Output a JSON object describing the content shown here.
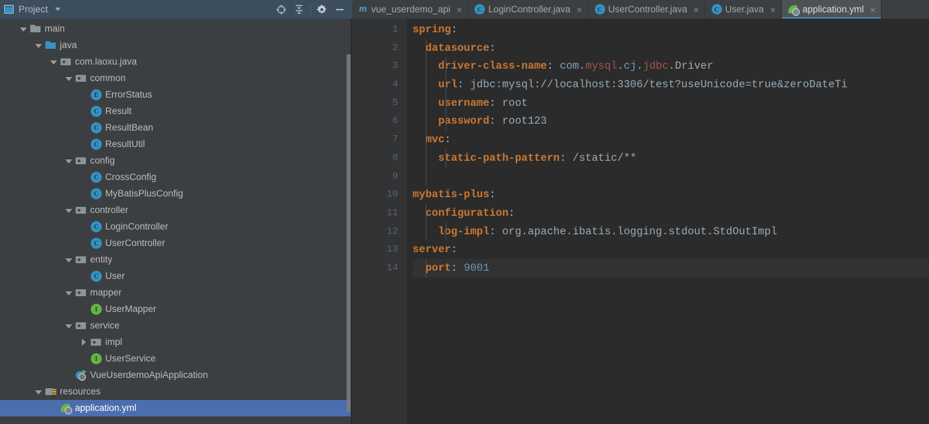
{
  "window": {
    "theme_bg": "#3c3f41",
    "editor_bg": "#2b2b2b",
    "selection_color": "#4b6eaf",
    "accent_color": "#4a88c7"
  },
  "project_panel": {
    "title": "Project",
    "dropdown_icon": "chevron-down-icon",
    "panel_icon": "project-panel-icon",
    "toolbar": [
      {
        "name": "locate-icon",
        "tooltip": "Select Opened File"
      },
      {
        "name": "collapse-all-icon",
        "tooltip": "Collapse All"
      },
      {
        "name": "gear-icon",
        "tooltip": "Settings"
      },
      {
        "name": "minimize-icon",
        "tooltip": "Hide"
      }
    ],
    "tree": [
      {
        "label": "main",
        "indent": 1,
        "arrow": "down",
        "icon": "folder",
        "kind": "folder",
        "selected": false
      },
      {
        "label": "java",
        "indent": 2,
        "arrow": "down",
        "icon": "folder-src",
        "kind": "folder",
        "selected": false
      },
      {
        "label": "com.laoxu.java",
        "indent": 3,
        "arrow": "down",
        "icon": "pkg",
        "kind": "package",
        "selected": false
      },
      {
        "label": "common",
        "indent": 4,
        "arrow": "down",
        "icon": "pkg",
        "kind": "package",
        "selected": false
      },
      {
        "label": "ErrorStatus",
        "indent": 5,
        "arrow": "none",
        "icon": "enum",
        "kind": "enum",
        "selected": false
      },
      {
        "label": "Result",
        "indent": 5,
        "arrow": "none",
        "icon": "class",
        "kind": "class",
        "selected": false
      },
      {
        "label": "ResultBean",
        "indent": 5,
        "arrow": "none",
        "icon": "class",
        "kind": "class",
        "selected": false
      },
      {
        "label": "ResultUtil",
        "indent": 5,
        "arrow": "none",
        "icon": "class",
        "kind": "class",
        "selected": false
      },
      {
        "label": "config",
        "indent": 4,
        "arrow": "down",
        "icon": "pkg",
        "kind": "package",
        "selected": false
      },
      {
        "label": "CrossConfig",
        "indent": 5,
        "arrow": "none",
        "icon": "class",
        "kind": "class",
        "selected": false
      },
      {
        "label": "MyBatisPlusConfig",
        "indent": 5,
        "arrow": "none",
        "icon": "class",
        "kind": "class",
        "selected": false
      },
      {
        "label": "controller",
        "indent": 4,
        "arrow": "down",
        "icon": "pkg",
        "kind": "package",
        "selected": false
      },
      {
        "label": "LoginController",
        "indent": 5,
        "arrow": "none",
        "icon": "class",
        "kind": "class",
        "selected": false
      },
      {
        "label": "UserController",
        "indent": 5,
        "arrow": "none",
        "icon": "class",
        "kind": "class",
        "selected": false
      },
      {
        "label": "entity",
        "indent": 4,
        "arrow": "down",
        "icon": "pkg",
        "kind": "package",
        "selected": false
      },
      {
        "label": "User",
        "indent": 5,
        "arrow": "none",
        "icon": "class",
        "kind": "class",
        "selected": false
      },
      {
        "label": "mapper",
        "indent": 4,
        "arrow": "down",
        "icon": "pkg",
        "kind": "package",
        "selected": false
      },
      {
        "label": "UserMapper",
        "indent": 5,
        "arrow": "none",
        "icon": "interface",
        "kind": "interface",
        "selected": false
      },
      {
        "label": "service",
        "indent": 4,
        "arrow": "down",
        "icon": "pkg",
        "kind": "package",
        "selected": false
      },
      {
        "label": "impl",
        "indent": 5,
        "arrow": "right",
        "icon": "pkg",
        "kind": "package",
        "selected": false
      },
      {
        "label": "UserService",
        "indent": 5,
        "arrow": "none",
        "icon": "interface",
        "kind": "interface",
        "selected": false
      },
      {
        "label": "VueUserdemoApiApplication",
        "indent": 4,
        "arrow": "none",
        "icon": "springapp",
        "kind": "spring-application",
        "selected": false
      },
      {
        "label": "resources",
        "indent": 2,
        "arrow": "down",
        "icon": "res",
        "kind": "resources-folder",
        "selected": false
      },
      {
        "label": "application.yml",
        "indent": 3,
        "arrow": "none",
        "icon": "spring",
        "kind": "yaml",
        "selected": true
      }
    ],
    "scrollbar": {
      "name": "tree-vertical-scrollbar"
    }
  },
  "editor": {
    "tabs": [
      {
        "label": "vue_userdemo_api",
        "icon": "maven-module-icon",
        "active": false,
        "closable": true
      },
      {
        "label": "LoginController.java",
        "icon": "java-class-icon",
        "active": false,
        "closable": true
      },
      {
        "label": "UserController.java",
        "icon": "java-class-icon",
        "active": false,
        "closable": true
      },
      {
        "label": "User.java",
        "icon": "java-class-icon",
        "active": false,
        "closable": true
      },
      {
        "label": "application.yml",
        "icon": "spring-yaml-icon",
        "active": true,
        "closable": true
      }
    ],
    "close_glyph": "×",
    "current_line": 14,
    "lines": [
      {
        "no": 1,
        "fold": "pent",
        "indent": 0,
        "tokens": [
          {
            "t": "spring",
            "c": "key"
          },
          {
            "t": ":",
            "c": "colon"
          }
        ]
      },
      {
        "no": 2,
        "fold": "pent",
        "indent": 1,
        "tokens": [
          {
            "t": "datasource",
            "c": "key"
          },
          {
            "t": ":",
            "c": "colon"
          }
        ]
      },
      {
        "no": 3,
        "fold": null,
        "indent": 2,
        "tokens": [
          {
            "t": "driver-class-name",
            "c": "key"
          },
          {
            "t": ": ",
            "c": "colon"
          },
          {
            "t": "com",
            "c": "t1"
          },
          {
            "t": ".",
            "c": "plain"
          },
          {
            "t": "mysql",
            "c": "t2"
          },
          {
            "t": ".",
            "c": "plain"
          },
          {
            "t": "cj",
            "c": "t3"
          },
          {
            "t": ".",
            "c": "plain"
          },
          {
            "t": "jdbc",
            "c": "t4"
          },
          {
            "t": ".",
            "c": "plain"
          },
          {
            "t": "Driver",
            "c": "plain"
          }
        ]
      },
      {
        "no": 4,
        "fold": null,
        "indent": 2,
        "tokens": [
          {
            "t": "url",
            "c": "key"
          },
          {
            "t": ": ",
            "c": "colon"
          },
          {
            "t": "jdbc:mysql://localhost:3306/test?useUnicode=true&zeroDateTi",
            "c": "plain"
          }
        ]
      },
      {
        "no": 5,
        "fold": null,
        "indent": 2,
        "tokens": [
          {
            "t": "username",
            "c": "key"
          },
          {
            "t": ": ",
            "c": "colon"
          },
          {
            "t": "root",
            "c": "plain"
          }
        ]
      },
      {
        "no": 6,
        "fold": "square",
        "indent": 2,
        "tokens": [
          {
            "t": "password",
            "c": "key"
          },
          {
            "t": ": ",
            "c": "colon"
          },
          {
            "t": "root123",
            "c": "plain"
          }
        ]
      },
      {
        "no": 7,
        "fold": "pent",
        "indent": 1,
        "tokens": [
          {
            "t": "mvc",
            "c": "key"
          },
          {
            "t": ":",
            "c": "colon"
          }
        ]
      },
      {
        "no": 8,
        "fold": "square",
        "indent": 2,
        "tokens": [
          {
            "t": "static-path-pattern",
            "c": "key"
          },
          {
            "t": ": ",
            "c": "colon"
          },
          {
            "t": "/static/**",
            "c": "plain"
          }
        ]
      },
      {
        "no": 9,
        "fold": null,
        "indent": 0,
        "tokens": []
      },
      {
        "no": 10,
        "fold": "pent",
        "indent": 0,
        "tokens": [
          {
            "t": "mybatis-plus",
            "c": "key"
          },
          {
            "t": ":",
            "c": "colon"
          }
        ]
      },
      {
        "no": 11,
        "fold": "pent",
        "indent": 1,
        "tokens": [
          {
            "t": "configuration",
            "c": "key"
          },
          {
            "t": ":",
            "c": "colon"
          }
        ]
      },
      {
        "no": 12,
        "fold": "square",
        "indent": 2,
        "tokens": [
          {
            "t": "log-impl",
            "c": "key"
          },
          {
            "t": ": ",
            "c": "colon"
          },
          {
            "t": "org.apache.ibatis.logging.stdout.StdOutImpl",
            "c": "plain"
          }
        ]
      },
      {
        "no": 13,
        "fold": "pent",
        "indent": 0,
        "tokens": [
          {
            "t": "server",
            "c": "key"
          },
          {
            "t": ":",
            "c": "colon"
          }
        ]
      },
      {
        "no": 14,
        "fold": "square",
        "indent": 1,
        "tokens": [
          {
            "t": "port",
            "c": "key"
          },
          {
            "t": ": ",
            "c": "colon"
          },
          {
            "t": "9001",
            "c": "num"
          }
        ]
      }
    ]
  }
}
